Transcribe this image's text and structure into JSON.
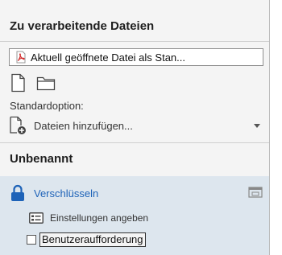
{
  "files_section": {
    "title": "Zu verarbeitende Dateien",
    "file_field_value": "Aktuell geöffnete Datei als Stan...",
    "default_option_label": "Standardoption:",
    "dropdown_value": "Dateien hinzufügen..."
  },
  "action_section": {
    "title": "Unbenannt",
    "action_name": "Verschlüsseln",
    "settings_label": "Einstellungen angeben",
    "prompt_label": "Benutzeraufforderung",
    "prompt_checked": false
  },
  "colors": {
    "panel_bg": "#f4f4f4",
    "action_bg": "#dde6ee",
    "accent_blue": "#1e63b8",
    "pdf_red": "#d32f2f"
  }
}
